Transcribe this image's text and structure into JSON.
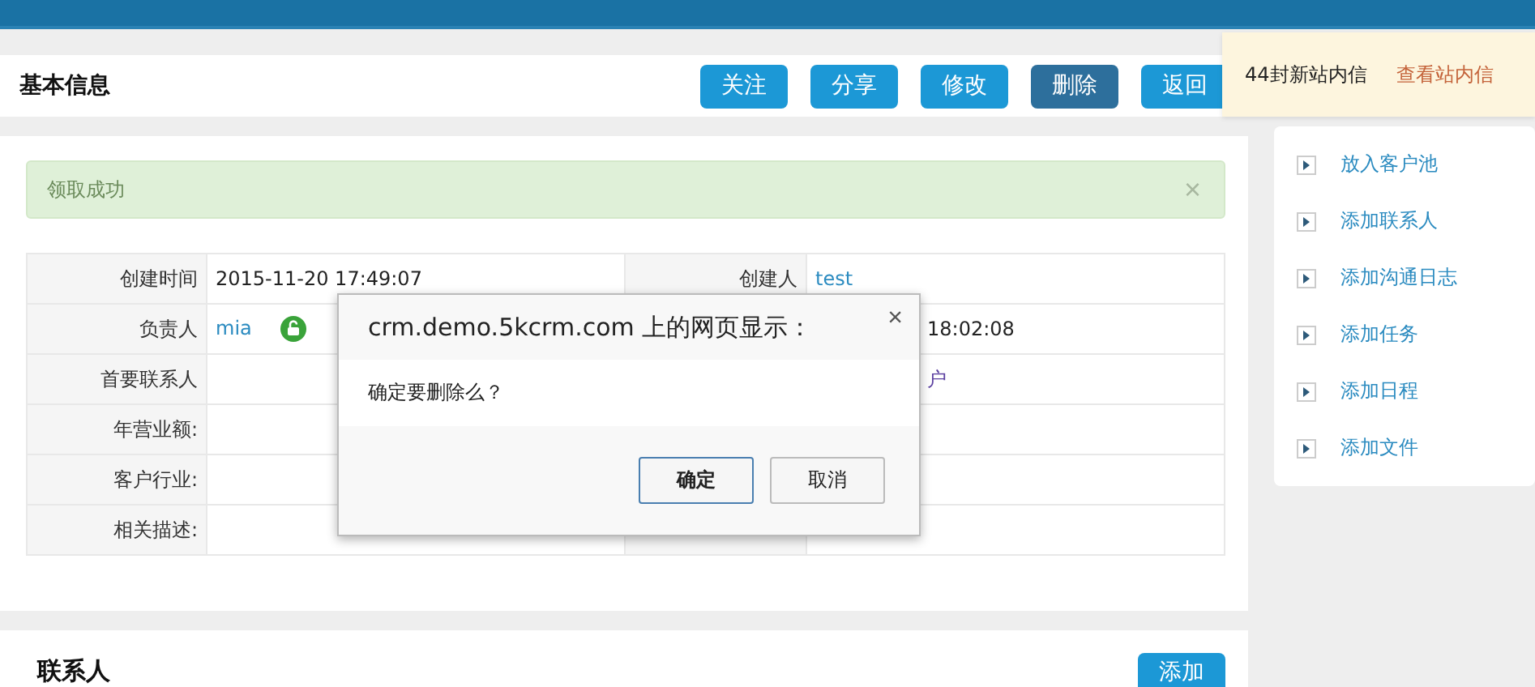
{
  "header": {
    "title": "基本信息",
    "buttons": [
      {
        "label": "关注",
        "kind": "primary"
      },
      {
        "label": "分享",
        "kind": "primary"
      },
      {
        "label": "修改",
        "kind": "primary"
      },
      {
        "label": "删除",
        "kind": "dark"
      },
      {
        "label": "返回",
        "kind": "primary"
      }
    ]
  },
  "notification": {
    "count": "44",
    "text": "封新站内信",
    "link": "查看站内信"
  },
  "alert": {
    "text": "领取成功",
    "close": "×"
  },
  "table": {
    "rows": [
      {
        "label": "创建时间",
        "value": "2015-11-20 17:49:07",
        "value_link": false,
        "lock": false,
        "label_2": "创建人",
        "value_2": "test",
        "value_2_link": true
      },
      {
        "label": "负责人",
        "value": "mia",
        "value_link": true,
        "lock": true,
        "value_2": "18:02:08",
        "value_2_link": false
      },
      {
        "label": "首要联系人",
        "lock": false,
        "value_2": "户",
        "value_2_link": true
      },
      {
        "label": "年营业额:",
        "lock": false
      },
      {
        "label": "客户行业:",
        "lock": false
      },
      {
        "label": "相关描述:",
        "lock": false
      }
    ]
  },
  "sidebar": {
    "items": [
      "放入客户池",
      "添加联系人",
      "添加沟通日志",
      "添加任务",
      "添加日程",
      "添加文件"
    ]
  },
  "contacts": {
    "title": "联系人",
    "button": "添加"
  },
  "dialog": {
    "title": "crm.demo.5kcrm.com 上的网页显示：",
    "close": "×",
    "message": "确定要删除么？",
    "buttons": [
      {
        "label": "确定",
        "kind": "default"
      },
      {
        "label": "取消",
        "kind": "normal"
      }
    ]
  }
}
